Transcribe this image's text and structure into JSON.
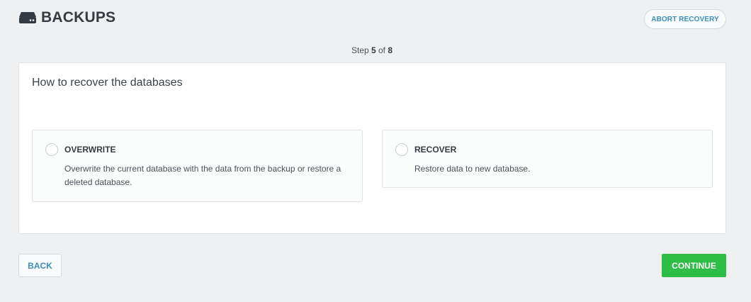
{
  "header": {
    "title": "BACKUPS",
    "icon": "hard-drive-icon",
    "abort_label": "ABORT RECOVERY"
  },
  "step": {
    "prefix": "Step",
    "current": "5",
    "of_label": "of",
    "total": "8"
  },
  "card": {
    "title": "How to recover the databases",
    "options": [
      {
        "title": "OVERWRITE",
        "description": "Overwrite the current database with the data from the backup or restore a deleted database.",
        "selected": false
      },
      {
        "title": "RECOVER",
        "description": "Restore data to new database.",
        "selected": false
      }
    ]
  },
  "footer": {
    "back_label": "BACK",
    "continue_label": "CONTINUE"
  },
  "colors": {
    "background": "#eef0f1",
    "accent_link": "#3c8eb8",
    "primary_button": "#2ebd45",
    "text": "#343b42"
  }
}
